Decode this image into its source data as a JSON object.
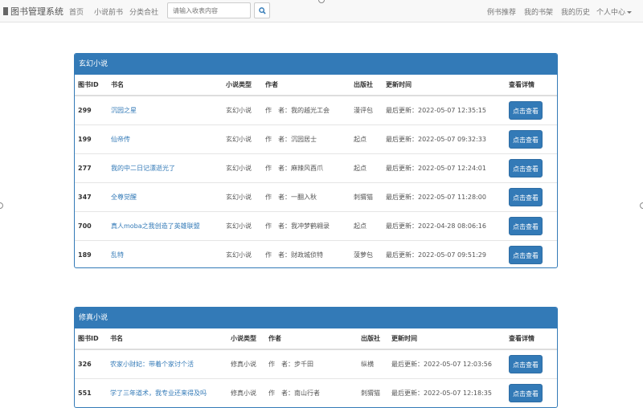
{
  "navbar": {
    "brand": "图书管理系统",
    "links": [
      "首页",
      "小说前书",
      "分类合社"
    ],
    "search_placeholder": "请输入收表内容",
    "right_links": [
      "例书推荐",
      "我的书架",
      "我的历史"
    ],
    "user_menu": "个人中心"
  },
  "panels": [
    {
      "title": "玄幻小说",
      "headers": [
        "图书ID",
        "书名",
        "小说类型",
        "作者",
        "出版社",
        "更新时间",
        "查看详情"
      ],
      "rows": [
        {
          "id": "299",
          "title": "沉园之星",
          "type": "玄幻小说",
          "author": "作　者：我的越光工会",
          "publisher": "漫评包",
          "updated": "最后更新：2022-05-07 12:35:15",
          "action": "点击查看"
        },
        {
          "id": "199",
          "title": "仙帝传",
          "type": "玄幻小说",
          "author": "作　者：沉园居士",
          "publisher": "起点",
          "updated": "最后更新：2022-05-07 09:32:33",
          "action": "点击查看"
        },
        {
          "id": "277",
          "title": "我的中二日记漂逝光了",
          "type": "玄幻小说",
          "author": "作　者：麻辣风酉爪",
          "publisher": "起点",
          "updated": "最后更新：2022-05-07 12:24:01",
          "action": "点击查看"
        },
        {
          "id": "347",
          "title": "全尊觉醒",
          "type": "玄幻小说",
          "author": "作　者：一翻入秋",
          "publisher": "刺猬猫",
          "updated": "最后更新：2022-05-07 11:28:00",
          "action": "点击查看"
        },
        {
          "id": "700",
          "title": "真人moba之我创造了英雄联盟",
          "type": "玄幻小说",
          "author": "作　者：我冲梦鹤翱录",
          "publisher": "起点",
          "updated": "最后更新：2022-04-28 08:06:16",
          "action": "点击查看"
        },
        {
          "id": "189",
          "title": "乱特",
          "type": "玄幻小说",
          "author": "作　者：财政城侦特",
          "publisher": "菠萝包",
          "updated": "最后更新：2022-05-07 09:51:29",
          "action": "点击查看"
        }
      ]
    },
    {
      "title": "修真小说",
      "headers": [
        "图书ID",
        "书名",
        "小说类型",
        "作者",
        "出版社",
        "更新时间",
        "查看详情"
      ],
      "rows": [
        {
          "id": "326",
          "title": "农家小财妃：带着个家讨个活",
          "type": "修真小说",
          "author": "作　者：步千田",
          "publisher": "纵横",
          "updated": "最后更新：2022-05-07 12:03:56",
          "action": "点击查看"
        },
        {
          "id": "551",
          "title": "学了三年道术，我专业还来得及吗",
          "type": "修真小说",
          "author": "作　者：南山行者",
          "publisher": "刺猬猫",
          "updated": "最后更新：2022-05-07 12:18:35",
          "action": "点击查看"
        }
      ]
    }
  ]
}
